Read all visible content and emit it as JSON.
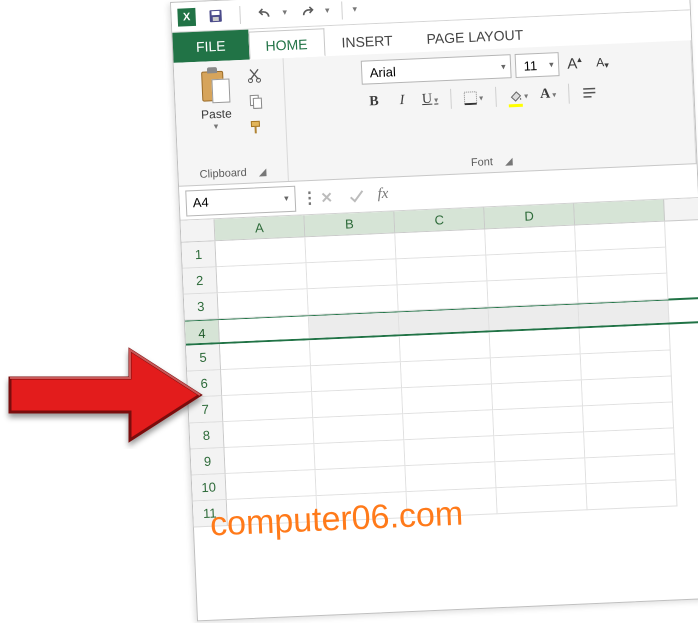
{
  "titlebar": {
    "app_icon_letter": "X"
  },
  "tabs": {
    "file": "FILE",
    "home": "HOME",
    "insert": "INSERT",
    "page_layout": "PAGE LAYOUT"
  },
  "clipboard": {
    "paste_label": "Paste",
    "group_label": "Clipboard"
  },
  "font": {
    "name": "Arial",
    "size": "11",
    "bold": "B",
    "italic": "I",
    "underline": "U",
    "increase": "A",
    "decrease": "A",
    "fontcolor_letter": "A",
    "group_label": "Font"
  },
  "namebox": {
    "value": "A4"
  },
  "formula_bar": {
    "fx_label": "fx"
  },
  "columns": [
    "A",
    "B",
    "C",
    "D"
  ],
  "rows": [
    "1",
    "2",
    "3",
    "4",
    "5",
    "6",
    "7",
    "8",
    "9",
    "10",
    "11"
  ],
  "selected_row": "4",
  "watermark": "computer06.com"
}
